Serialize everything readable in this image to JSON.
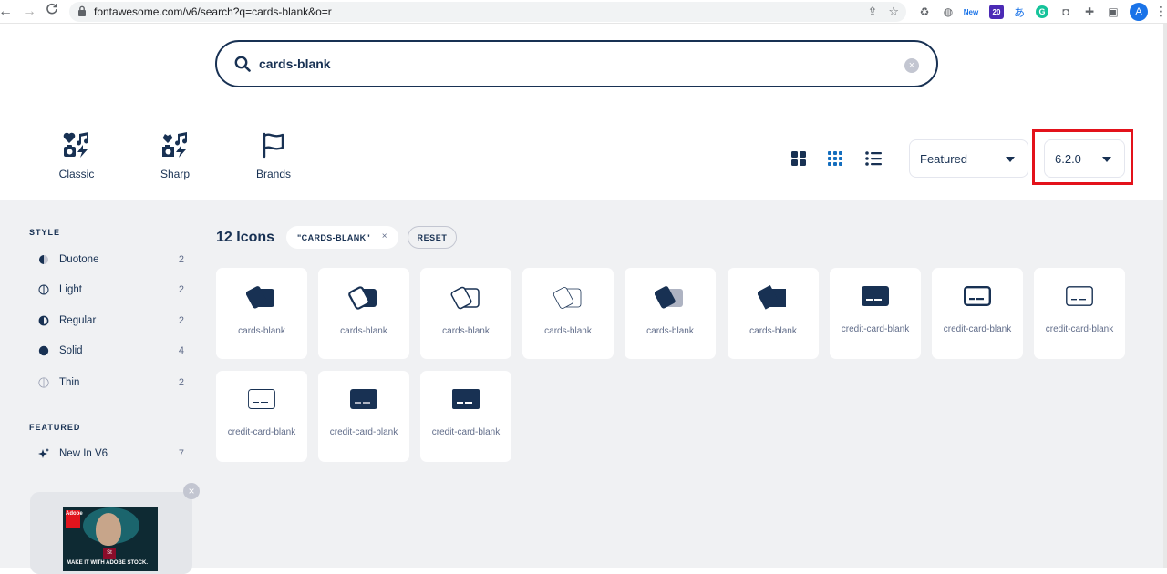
{
  "browser": {
    "url": "fontawesome.com/v6/search?q=cards-blank&o=r",
    "extensions": [
      {
        "name": "recycle-icon"
      },
      {
        "name": "globe-icon"
      },
      {
        "name": "new-badge",
        "label": "New"
      },
      {
        "name": "graduation-cap-icon",
        "label": "20"
      },
      {
        "name": "translate-icon"
      },
      {
        "name": "grammarly-icon"
      },
      {
        "name": "camera-icon"
      },
      {
        "name": "puzzle-icon"
      },
      {
        "name": "sidebar-icon"
      }
    ],
    "avatar": "A"
  },
  "search": {
    "value": "cards-blank"
  },
  "families": [
    {
      "name": "family-classic",
      "label": "Classic"
    },
    {
      "name": "family-sharp",
      "label": "Sharp"
    },
    {
      "name": "family-brands",
      "label": "Brands"
    }
  ],
  "sort": {
    "value": "Featured"
  },
  "version": {
    "value": "6.2.0"
  },
  "sidebar": {
    "style_title": "STYLE",
    "styles": [
      {
        "label": "Duotone",
        "count": "2",
        "icon": "circle-half-icon"
      },
      {
        "label": "Light",
        "count": "2",
        "icon": "circle-light-icon"
      },
      {
        "label": "Regular",
        "count": "2",
        "icon": "circle-half-regular-icon"
      },
      {
        "label": "Solid",
        "count": "4",
        "icon": "circle-solid-icon"
      },
      {
        "label": "Thin",
        "count": "2",
        "icon": "circle-thin-icon"
      }
    ],
    "featured_title": "FEATURED",
    "featured": [
      {
        "label": "New In V6",
        "count": "7",
        "icon": "sparkles-icon"
      }
    ],
    "ad": {
      "logo": "Adobe",
      "badge": "St",
      "tagline": "MAKE IT WITH ADOBE STOCK."
    }
  },
  "results": {
    "count": "12 Icons",
    "chip": "\"CARDS-BLANK\"",
    "chip_close": "×",
    "reset": "RESET",
    "icons": [
      {
        "name": "cards-blank",
        "style": "solid"
      },
      {
        "name": "cards-blank",
        "style": "regular"
      },
      {
        "name": "cards-blank",
        "style": "light"
      },
      {
        "name": "cards-blank",
        "style": "thin"
      },
      {
        "name": "cards-blank",
        "style": "duotone"
      },
      {
        "name": "cards-blank",
        "style": "sharp-solid"
      },
      {
        "name": "credit-card-blank",
        "style": "solid"
      },
      {
        "name": "credit-card-blank",
        "style": "regular"
      },
      {
        "name": "credit-card-blank",
        "style": "light"
      },
      {
        "name": "credit-card-blank",
        "style": "thin"
      },
      {
        "name": "credit-card-blank",
        "style": "duotone"
      },
      {
        "name": "credit-card-blank",
        "style": "sharp-solid"
      }
    ]
  },
  "colors": {
    "navy": "#183153",
    "highlight": "#e3121b",
    "background": "#f0f1f3",
    "grey_text": "#616d8a",
    "active_view": "#146ebe"
  }
}
